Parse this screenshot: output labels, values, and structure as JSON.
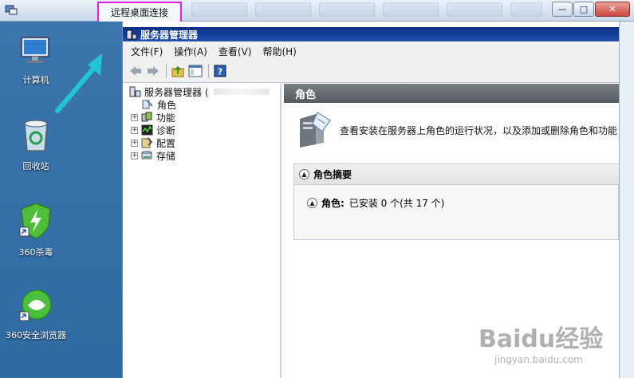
{
  "rdp": {
    "title": "远程桌面连接",
    "buttons": [
      "—",
      "□",
      "✕"
    ]
  },
  "desktop": {
    "icons": [
      {
        "label": "计算机",
        "icon": "computer-icon"
      },
      {
        "label": "回收站",
        "icon": "recycle-bin-icon"
      },
      {
        "label": "360杀毒",
        "icon": "shield-icon"
      },
      {
        "label": "360安全浏览器",
        "icon": "browser-icon"
      }
    ]
  },
  "server_manager": {
    "title": "服务器管理器",
    "menu": [
      "文件(F)",
      "操作(A)",
      "查看(V)",
      "帮助(H)"
    ],
    "tree": {
      "root": "服务器管理器 (",
      "items": [
        "角色",
        "功能",
        "诊断",
        "配置",
        "存储"
      ]
    },
    "content": {
      "header": "角色",
      "description": "查看安装在服务器上角色的运行状况，以及添加或删除角色和功能",
      "summary_title": "角色摘要",
      "roles_label": "角色:",
      "roles_status": "已安装 0 个(共 17 个)"
    }
  },
  "watermark": {
    "brand": "Baidu经验",
    "url": "jingyan.baidu.com"
  },
  "colors": {
    "highlight": "#e020e0",
    "arrow": "#22c4d8",
    "titlebar": "#0b2f82"
  }
}
